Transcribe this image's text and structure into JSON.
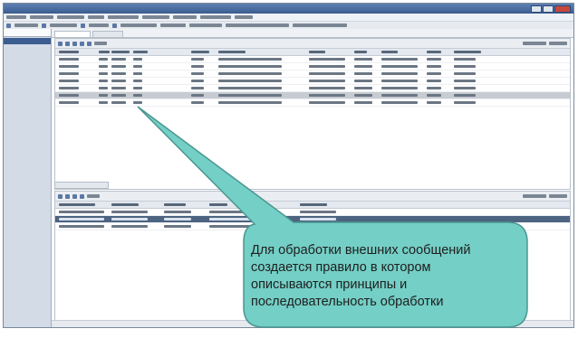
{
  "callout": {
    "text": "Для обработки внешних сообщений\nсоздается правило в котором\nописываются принципы и\nпоследовательность обработки",
    "fill_color": "#74cfc6",
    "stroke_color": "#4b9690"
  },
  "colors": {
    "title_bar": "#3a5c8f",
    "selected_row": "#c7ccd2",
    "highlight_row": "#4d6480",
    "nav_panel": "#d3dbe6"
  },
  "upper_grid": {
    "row_count": 7,
    "selected_row": 5
  },
  "lower_grid": {
    "row_count": 3,
    "highlighted_row": 1
  }
}
